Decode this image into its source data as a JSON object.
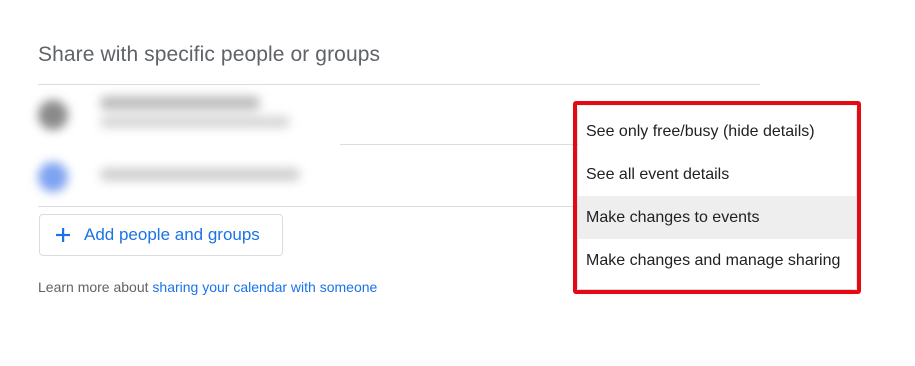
{
  "section": {
    "title": "Share with specific people or groups"
  },
  "add_button": {
    "label": "Add people and groups",
    "icon": "plus-icon"
  },
  "learn_more": {
    "prefix": "Learn more about ",
    "link_text": "sharing your calendar with someone"
  },
  "permission_menu": {
    "items": [
      {
        "label": "See only free/busy (hide details)",
        "active": false
      },
      {
        "label": "See all event details",
        "active": false
      },
      {
        "label": "Make changes to events",
        "active": true
      },
      {
        "label": "Make changes and manage sharing",
        "active": false
      }
    ]
  },
  "colors": {
    "accent": "#1a73e8",
    "highlight_border": "#e50914",
    "active_item_bg": "#eeeeee",
    "divider": "#dadce0"
  }
}
